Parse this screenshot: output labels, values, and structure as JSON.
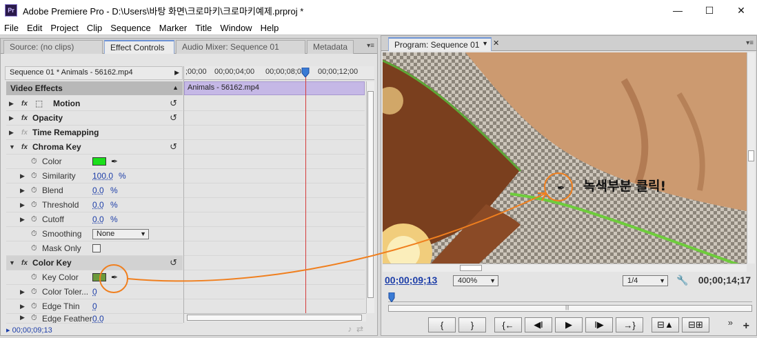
{
  "window": {
    "app_icon": "Pr",
    "title": "Adobe Premiere Pro - D:\\Users\\바탕 화면\\크로마키\\크로마키예제.prproj *",
    "controls": [
      "—",
      "☐",
      "✕"
    ]
  },
  "menu": [
    "File",
    "Edit",
    "Project",
    "Clip",
    "Sequence",
    "Marker",
    "Title",
    "Window",
    "Help"
  ],
  "left_panel": {
    "tabs": [
      {
        "label": "Source: (no clips)",
        "active": false
      },
      {
        "label": "Effect Controls",
        "active": true
      },
      {
        "label": "Audio Mixer: Sequence 01",
        "active": false
      },
      {
        "label": "Metadata",
        "active": false
      }
    ],
    "tab_menu_icon": "▾≡",
    "sequence_label": "Sequence 01 * Animals - 56162.mp4",
    "ruler_ticks": [
      ";00;00",
      "00;00;04;00",
      "00;00;08;00",
      "00;00;12;00"
    ],
    "clip_label": "Animals - 56162.mp4",
    "video_effects_label": "Video Effects",
    "effects": [
      {
        "name": "Motion",
        "kind": "effect",
        "reset": true,
        "enabled": true
      },
      {
        "name": "Opacity",
        "kind": "effect",
        "reset": true,
        "enabled": true
      },
      {
        "name": "Time Remapping",
        "kind": "effect",
        "reset": false,
        "enabled": false
      },
      {
        "name": "Chroma Key",
        "kind": "effect",
        "reset": true,
        "enabled": true,
        "expanded": true
      },
      {
        "name": "Color",
        "kind": "color",
        "color": "#1bdf1b"
      },
      {
        "name": "Similarity",
        "kind": "value",
        "value": "100.0",
        "unit": "%"
      },
      {
        "name": "Blend",
        "kind": "value",
        "value": "0.0",
        "unit": "%"
      },
      {
        "name": "Threshold",
        "kind": "value",
        "value": "0.0",
        "unit": "%"
      },
      {
        "name": "Cutoff",
        "kind": "value",
        "value": "0.0",
        "unit": "%"
      },
      {
        "name": "Smoothing",
        "kind": "dropdown",
        "value": "None"
      },
      {
        "name": "Mask Only",
        "kind": "checkbox",
        "checked": false
      },
      {
        "name": "Color Key",
        "kind": "effect",
        "reset": true,
        "enabled": true,
        "expanded": true,
        "highlight": true
      },
      {
        "name": "Key Color",
        "kind": "color",
        "color": "#6b9a3c"
      },
      {
        "name": "Color Toler...",
        "kind": "value",
        "value": "0",
        "unit": ""
      },
      {
        "name": "Edge Thin",
        "kind": "value",
        "value": "0",
        "unit": ""
      },
      {
        "name": "Edge Feather",
        "kind": "value",
        "value": "0.0",
        "unit": ""
      }
    ],
    "footer_timecode": "00;00;09;13"
  },
  "right_panel": {
    "tab_label": "Program: Sequence 01",
    "tab_menu_icon": "▾≡",
    "timecode": "00;00;09;13",
    "zoom": "400%",
    "resolution": "1/4",
    "duration": "00;00;14;17",
    "transport": [
      "{",
      "}",
      "{←",
      "◀I",
      "▶",
      "I▶",
      "→}",
      "⊟▲",
      "⊟⊞"
    ],
    "more": "»",
    "add": "+"
  },
  "annotation": {
    "text": "녹색부분 클릭!",
    "color": "#f07f1e"
  },
  "colors": {
    "accent_blue": "#1d3ea8",
    "playhead_red": "#d43a3a",
    "clip_purple": "#c5b8e6"
  }
}
